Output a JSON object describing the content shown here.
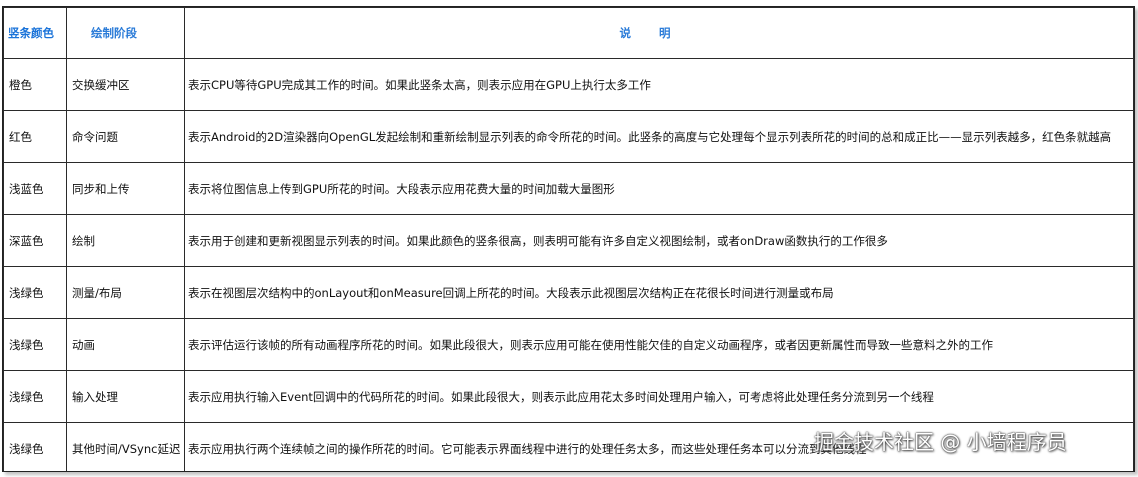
{
  "table": {
    "headers": [
      "竖条颜色",
      "绘制阶段",
      "说明"
    ],
    "rows": [
      {
        "color": "橙色",
        "stage": "交换缓冲区",
        "description": "表示CPU等待GPU完成其工作的时间。如果此竖条太高，则表示应用在GPU上执行太多工作"
      },
      {
        "color": "红色",
        "stage": "命令问题",
        "description": "表示Android的2D渲染器向OpenGL发起绘制和重新绘制显示列表的命令所花的时间。此竖条的高度与它处理每个显示列表所花的时间的总和成正比——显示列表越多，红色条就越高"
      },
      {
        "color": "浅蓝色",
        "stage": "同步和上传",
        "description": "表示将位图信息上传到GPU所花的时间。大段表示应用花费大量的时间加载大量图形"
      },
      {
        "color": "深蓝色",
        "stage": "绘制",
        "description": "表示用于创建和更新视图显示列表的时间。如果此颜色的竖条很高，则表明可能有许多自定义视图绘制，或者onDraw函数执行的工作很多"
      },
      {
        "color": "浅绿色",
        "stage": "测量/布局",
        "description": "表示在视图层次结构中的onLayout和onMeasure回调上所花的时间。大段表示此视图层次结构正在花很长时间进行测量或布局"
      },
      {
        "color": "浅绿色",
        "stage": "动画",
        "description": "表示评估运行该帧的所有动画程序所花的时间。如果此段很大，则表示应用可能在使用性能欠佳的自定义动画程序，或者因更新属性而导致一些意料之外的工作"
      },
      {
        "color": "浅绿色",
        "stage": "输入处理",
        "description": "表示应用执行输入Event回调中的代码所花的时间。如果此段很大，则表示此应用花太多时间处理用户输入，可考虑将此处理任务分流到另一个线程"
      },
      {
        "color": "浅绿色",
        "stage": "其他时间/VSync延迟",
        "description": "表示应用执行两个连续帧之间的操作所花的时间。它可能表示界面线程中进行的处理任务太多，而这些处理任务本可以分流到其他线程"
      }
    ]
  },
  "watermark": "掘金技术社区 @ 小墙程序员",
  "colors": {
    "header_text": "#2a7bd8",
    "border": "#2a2a2a",
    "text": "#111111"
  }
}
